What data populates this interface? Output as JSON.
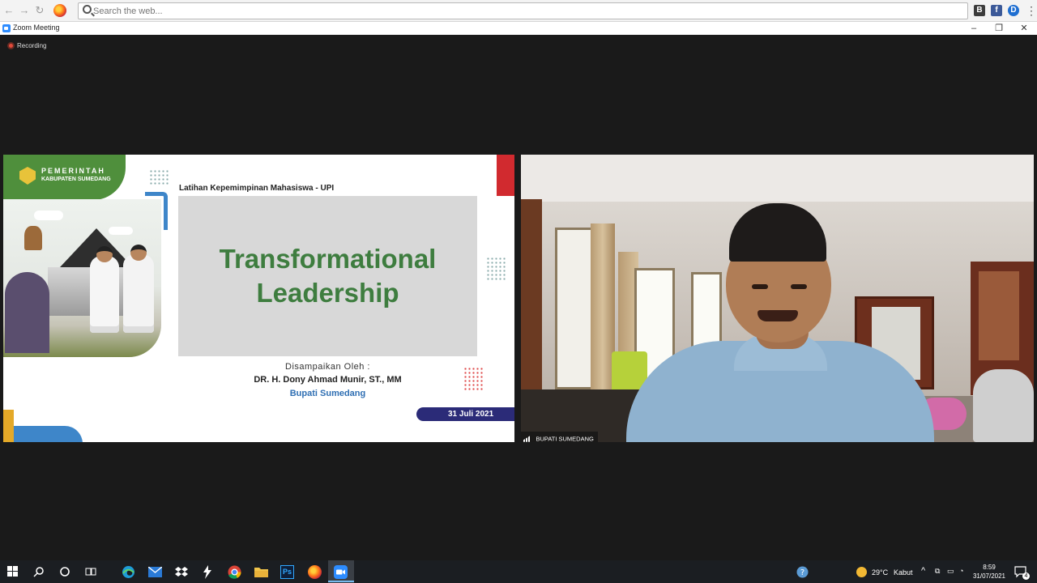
{
  "browser": {
    "search_placeholder": "Search the web...",
    "extensions": [
      {
        "icon": "bookmark-icon",
        "letter": "B",
        "color": "#3c3c3c"
      },
      {
        "icon": "facebook-icon",
        "letter": "f",
        "color": "#3b5998"
      },
      {
        "icon": "d-extension-icon",
        "letter": "D",
        "color": "#1f6fd1"
      }
    ]
  },
  "zoom": {
    "window_title": "Zoom Meeting",
    "recording_label": "Recording",
    "participant_name": "BUPATI SUMEDANG"
  },
  "slide": {
    "org_line1": "PEMERINTAH",
    "org_line2": "KABUPATEN SUMEDANG",
    "subtitle": "Latihan Kepemimpinan Mahasiswa - UPI",
    "title_line1": "Transformational",
    "title_line2": "Leadership",
    "presented_by": "Disampaikan Oleh :",
    "presenter_name": "DR. H. Dony Ahmad Munir, ST., MM",
    "presenter_role": "Bupati Sumedang",
    "date": "31 Juli 2021",
    "colors": {
      "green": "#3e7d3f",
      "red": "#d12a2f",
      "navy": "#2b2b78",
      "blue": "#2f6fb3"
    }
  },
  "taskbar": {
    "apps": [
      "windows-start-icon",
      "search-icon",
      "cortana-icon",
      "task-view-icon",
      "edge-icon",
      "mail-icon",
      "dropbox-icon",
      "lightning-app-icon",
      "chrome-icon",
      "file-explorer-icon",
      "photoshop-icon",
      "firefox-icon",
      "zoom-icon"
    ],
    "weather_temp": "29°C",
    "weather_desc": "Kabut",
    "time": "8:59",
    "date": "31/07/2021",
    "notification_count": "4",
    "ps_label": "Ps"
  }
}
